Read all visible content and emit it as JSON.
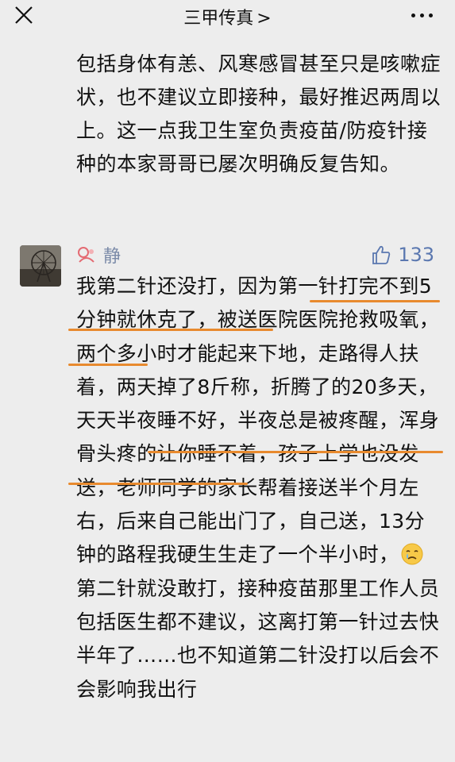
{
  "header": {
    "title": "三甲传真",
    "chevron": ">",
    "close_icon": "close-icon",
    "more_icon": "more-dots-icon"
  },
  "previous_comment": {
    "text": "包括身体有恙、风寒感冒甚至只是咳嗽症状，也不建议立即接种，最好推迟两周以上。这一点我卫生室负责疫苗/防疫针接种的本家哥哥已屡次明确反复告知。"
  },
  "comment": {
    "username": "静",
    "like_count": "133",
    "text_part1": "我第二针还没打，因为第一针打完不到5分钟就休克了，被送医院医院抢救吸氧，两个多小时才能起来下地，走路得人扶着，两天掉了8斤称，折腾了的20多天，天天半夜睡不好，半夜总是被疼醒，浑身骨头疼的让你睡不着，孩子上学也没发送，老师同学的家长帮着接送半个月左右，后来自己能出门了，自己送，13分钟的路程我硬生生走了一个半小时，",
    "emoji": "crying-face-icon",
    "text_part2": "第二针就没敢打，接种疫苗那里工作人员包括医生都不建议，这离打第一针过去快半年了……也不知道第二针没打以后会不会影响我出行"
  },
  "colors": {
    "background": "#ededed",
    "link_blue": "#5b78b0",
    "highlight": "#e88a2e"
  }
}
